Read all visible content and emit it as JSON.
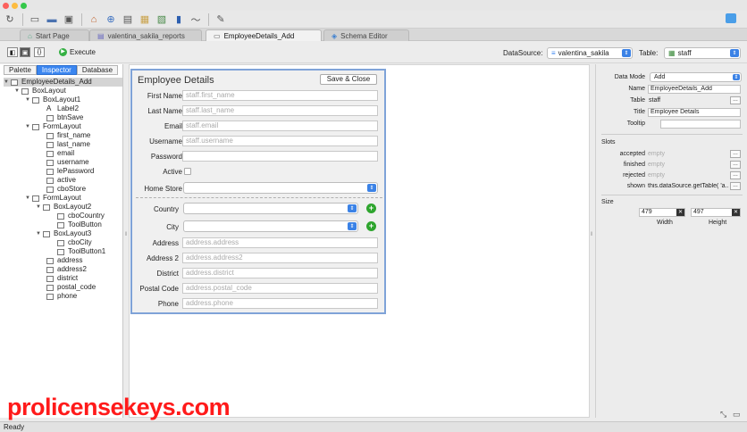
{
  "toolbar_icons": [
    "reload-icon",
    "new-file-icon",
    "open-folder-icon",
    "save-icon",
    "home-icon",
    "search-icon",
    "database-icon",
    "sql-icon",
    "query-icon",
    "book-icon",
    "activity-icon",
    "brush-icon"
  ],
  "tabs": [
    {
      "label": "Start Page",
      "icon": "home-icon"
    },
    {
      "label": "valentina_sakila_reports",
      "icon": "report-icon"
    },
    {
      "label": "EmployeeDetails_Add",
      "icon": "form-icon"
    },
    {
      "label": "Schema Editor",
      "icon": "schema-icon"
    }
  ],
  "subbar": {
    "execute": "Execute",
    "datasource_label": "DataSource:",
    "datasource_value": "valentina_sakila",
    "table_label": "Table:",
    "table_value": "staff"
  },
  "left_tabs": [
    "Palette",
    "Inspector",
    "Database"
  ],
  "tree": [
    {
      "label": "EmployeeDetails_Add"
    },
    {
      "label": "BoxLayout"
    },
    {
      "label": "BoxLayout1"
    },
    {
      "label": "Label2"
    },
    {
      "label": "btnSave"
    },
    {
      "label": "FormLayout"
    },
    {
      "label": "first_name"
    },
    {
      "label": "last_name"
    },
    {
      "label": "email"
    },
    {
      "label": "username"
    },
    {
      "label": "lePassword"
    },
    {
      "label": "active"
    },
    {
      "label": "cboStore"
    },
    {
      "label": "FormLayout"
    },
    {
      "label": "BoxLayout2"
    },
    {
      "label": "cboCountry"
    },
    {
      "label": "ToolButton"
    },
    {
      "label": "BoxLayout3"
    },
    {
      "label": "cboCity"
    },
    {
      "label": "ToolButton1"
    },
    {
      "label": "address"
    },
    {
      "label": "address2"
    },
    {
      "label": "district"
    },
    {
      "label": "postal_code"
    },
    {
      "label": "phone"
    }
  ],
  "form": {
    "title": "Employee Details",
    "save_button": "Save & Close",
    "fields": [
      {
        "label": "First Name",
        "placeholder": "staff.first_name"
      },
      {
        "label": "Last Name",
        "placeholder": "staff.last_name"
      },
      {
        "label": "Email",
        "placeholder": "staff.email"
      },
      {
        "label": "Username",
        "placeholder": "staff.username"
      },
      {
        "label": "Password",
        "placeholder": ""
      }
    ],
    "active_label": "Active",
    "home_store_label": "Home Store",
    "country_label": "Country",
    "city_label": "City",
    "fields2": [
      {
        "label": "Address",
        "placeholder": "address.address"
      },
      {
        "label": "Address 2",
        "placeholder": "address.address2"
      },
      {
        "label": "District",
        "placeholder": "address.district"
      },
      {
        "label": "Postal Code",
        "placeholder": "address.postal_code"
      },
      {
        "label": "Phone",
        "placeholder": "address.phone"
      }
    ]
  },
  "props": {
    "data_mode_label": "Data Mode",
    "data_mode": "Add",
    "name_label": "Name",
    "name": "EmployeeDetails_Add",
    "table_label": "Table",
    "table": "staff",
    "title_label": "Title",
    "title": "Employee Details",
    "tooltip_label": "Tooltip",
    "tooltip": "",
    "slots_header": "Slots",
    "slots": [
      {
        "label": "accepted",
        "value": "empty"
      },
      {
        "label": "finished",
        "value": "empty"
      },
      {
        "label": "rejected",
        "value": "empty"
      },
      {
        "label": "shown",
        "value": "this.dataSource.getTable( 'a..."
      }
    ],
    "size_header": "Size",
    "width": "479",
    "height": "497",
    "width_label": "Width",
    "height_label": "Height"
  },
  "status": "Ready",
  "watermark": "prolicensekeys.com",
  "colors": {
    "accent": "#3b86f0",
    "form_border": "#7fa3d8",
    "watermark": "#ff1a1a",
    "plus": "#2ea52e"
  }
}
